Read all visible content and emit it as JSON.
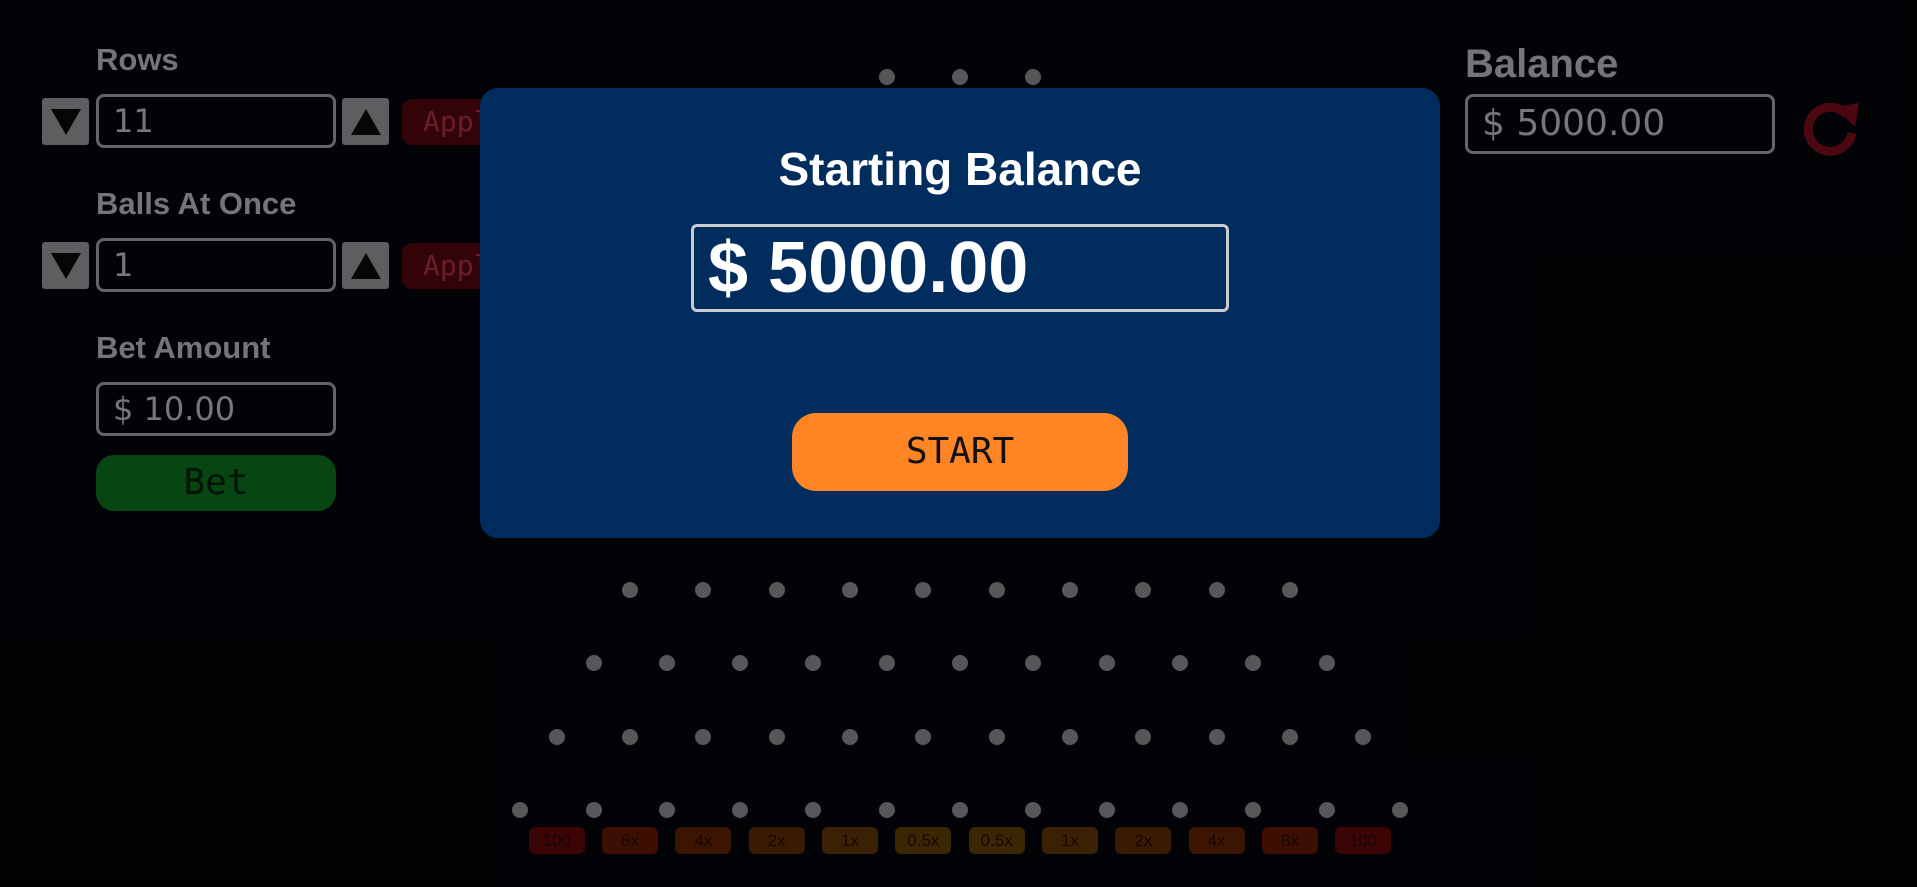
{
  "controls": {
    "rows": {
      "label": "Rows",
      "value": "11",
      "apply_label": "Apply"
    },
    "balls": {
      "label": "Balls At Once",
      "value": "1",
      "apply_label": "Apply"
    },
    "bet": {
      "label": "Bet Amount",
      "value": "$ 10.00",
      "button_label": "Bet"
    }
  },
  "balance": {
    "label": "Balance",
    "value": "$ 5000.00"
  },
  "board": {
    "multipliers": [
      "100",
      "8x",
      "4x",
      "2x",
      "1x",
      "0.5x",
      "0.5x",
      "1x",
      "2x",
      "4x",
      "8x",
      "100"
    ],
    "slot_colors": [
      "#6d0a0a",
      "#6f1d05",
      "#6c2705",
      "#6a3106",
      "#6b3c07",
      "#6a4807",
      "#6a4807",
      "#6b3c07",
      "#6a3106",
      "#6c2705",
      "#6f1d05",
      "#6d0a0a"
    ]
  },
  "modal": {
    "title": "Starting Balance",
    "amount": "$ 5000.00",
    "start_label": "START"
  },
  "colors": {
    "modal_bg": "#012d5e",
    "start_button": "#ff8424",
    "bet_button": "#0d7f22",
    "apply_button": "#5c0710",
    "reset_icon": "#8a1020"
  },
  "icons": {
    "decrement": "triangle-down-icon",
    "increment": "triangle-up-icon",
    "reset": "refresh-icon"
  }
}
